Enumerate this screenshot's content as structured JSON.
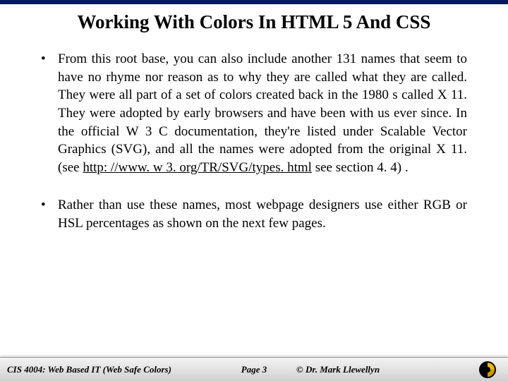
{
  "title": "Working With Colors In HTML 5 And CSS",
  "bullets": [
    {
      "pre": "From this root base, you can also include another 131 names that seem to have no rhyme nor reason as to why they are called what they are called.  They were all part of a set of colors created back in the 1980 s called X 11.  They were adopted by early browsers and have been with us ever since.  In the official W 3 C documentation, they're listed under Scalable Vector Graphics (SVG), and all the names were adopted from the original X 11.  (see ",
      "link": "http: //www. w 3. org/TR/SVG/types. html",
      "post": " see section 4. 4) ."
    },
    {
      "pre": "Rather than use these names, most webpage designers use either RGB or HSL percentages as shown on the next few pages.",
      "link": "",
      "post": ""
    }
  ],
  "footer": {
    "course": "CIS 4004: Web Based IT (Web Safe Colors)",
    "page": "Page 3",
    "author": "© Dr. Mark Llewellyn"
  }
}
